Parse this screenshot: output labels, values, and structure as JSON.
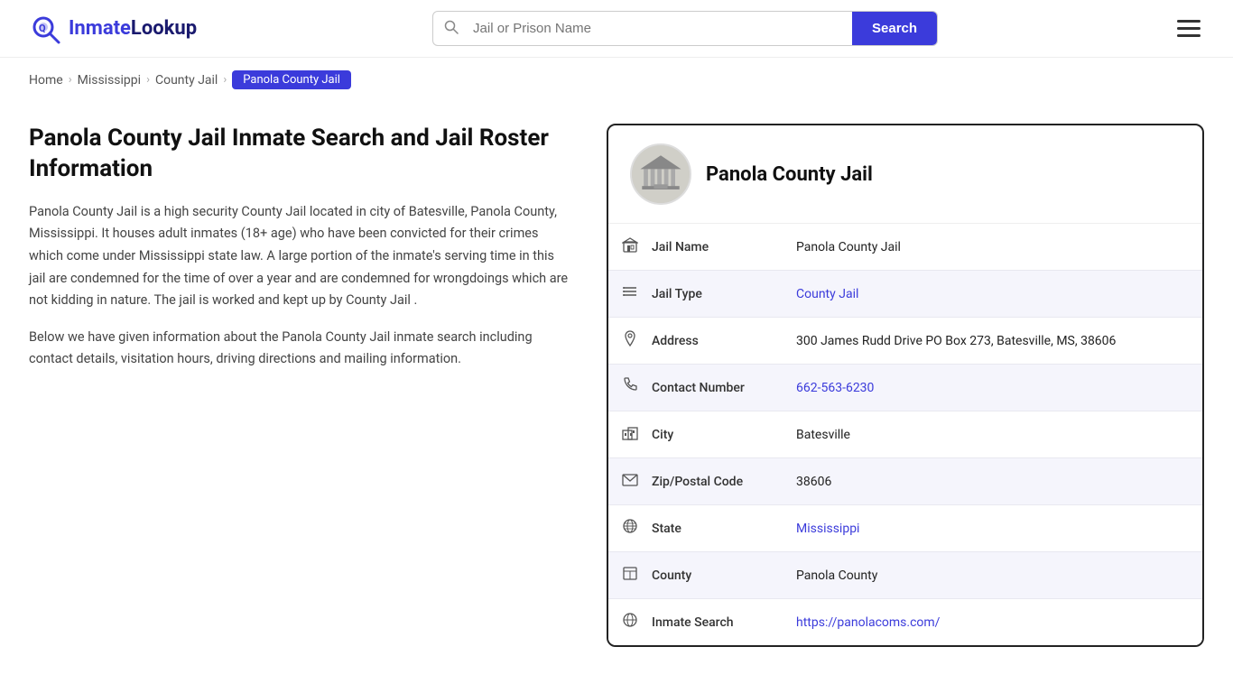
{
  "site": {
    "name_prefix": "Inmate",
    "name_suffix": "Lookup",
    "logo_alt": "InmateLookup"
  },
  "header": {
    "search_placeholder": "Jail or Prison Name",
    "search_button_label": "Search"
  },
  "breadcrumb": {
    "items": [
      {
        "label": "Home",
        "href": "#"
      },
      {
        "label": "Mississippi",
        "href": "#"
      },
      {
        "label": "County Jail",
        "href": "#"
      }
    ],
    "current": "Panola County Jail"
  },
  "main": {
    "page_title": "Panola County Jail Inmate Search and Jail Roster Information",
    "desc1": "Panola County Jail is a high security County Jail located in city of Batesville, Panola County, Mississippi. It houses adult inmates (18+ age) who have been convicted for their crimes which come under Mississippi state law. A large portion of the inmate's serving time in this jail are condemned for the time of over a year and are condemned for wrongdoings which are not kidding in nature. The jail is worked and kept up by County Jail .",
    "desc2": "Below we have given information about the Panola County Jail inmate search including contact details, visitation hours, driving directions and mailing information."
  },
  "card": {
    "title": "Panola County Jail",
    "fields": [
      {
        "icon": "building-icon",
        "icon_char": "🏛",
        "label": "Jail Name",
        "value": "Panola County Jail",
        "link": null
      },
      {
        "icon": "list-icon",
        "icon_char": "☰",
        "label": "Jail Type",
        "value": "County Jail",
        "link": "#"
      },
      {
        "icon": "pin-icon",
        "icon_char": "📍",
        "label": "Address",
        "value": "300 James Rudd Drive PO Box 273, Batesville, MS, 38606",
        "link": null
      },
      {
        "icon": "phone-icon",
        "icon_char": "📞",
        "label": "Contact Number",
        "value": "662-563-6230",
        "link": "tel:662-563-6230"
      },
      {
        "icon": "city-icon",
        "icon_char": "🏙",
        "label": "City",
        "value": "Batesville",
        "link": null
      },
      {
        "icon": "zip-icon",
        "icon_char": "✉",
        "label": "Zip/Postal Code",
        "value": "38606",
        "link": null
      },
      {
        "icon": "globe-icon",
        "icon_char": "🌐",
        "label": "State",
        "value": "Mississippi",
        "link": "#"
      },
      {
        "icon": "county-icon",
        "icon_char": "🗺",
        "label": "County",
        "value": "Panola County",
        "link": null
      },
      {
        "icon": "search-icon",
        "icon_char": "🔍",
        "label": "Inmate Search",
        "value": "https://panolacoms.com/",
        "link": "https://panolacoms.com/"
      }
    ]
  }
}
